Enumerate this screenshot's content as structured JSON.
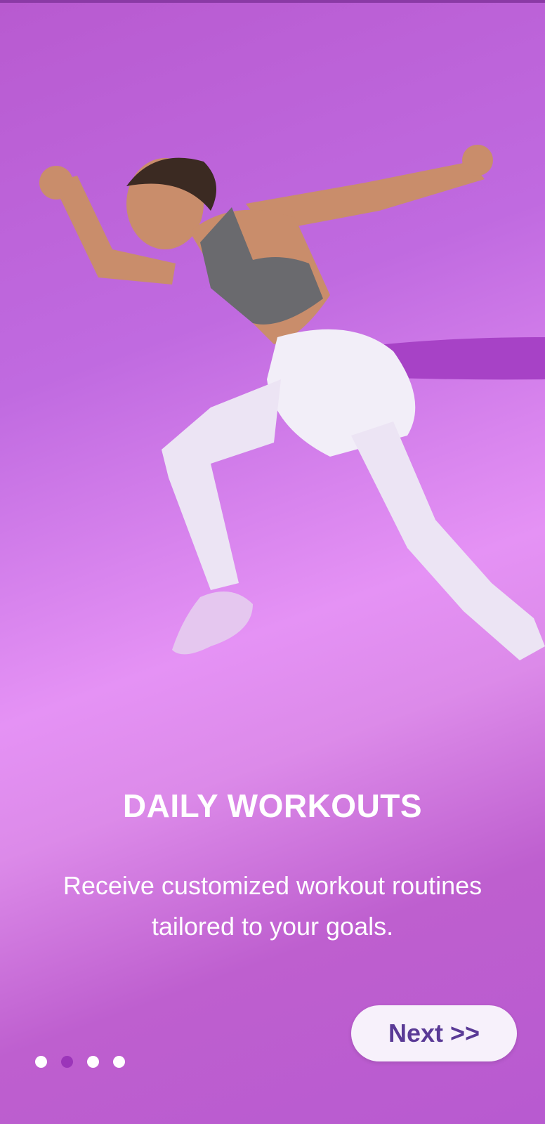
{
  "onboarding": {
    "title": "DAILY WORKOUTS",
    "subtitle": "Receive customized workout routines tailored to your goals.",
    "next_label": "Next >>",
    "page_indicator": {
      "total": 4,
      "active_index": 1
    }
  },
  "colors": {
    "accent": "#9b35b9",
    "background_start": "#b85ad0",
    "background_mid": "#e592f5",
    "button_text": "#5a3a96",
    "button_bg": "#f7f1fb"
  }
}
